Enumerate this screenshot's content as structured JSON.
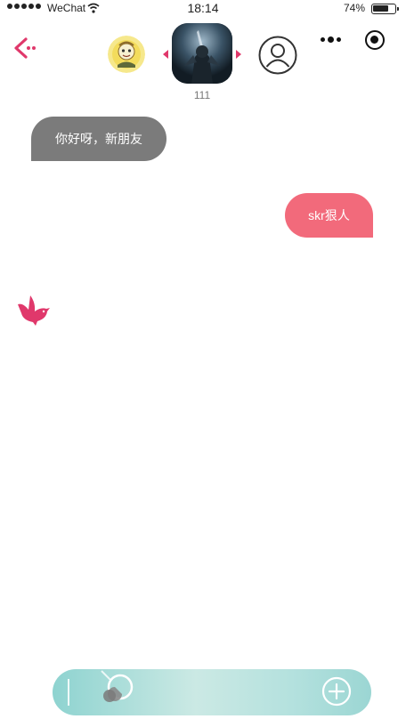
{
  "status_bar": {
    "carrier": "WeChat",
    "time": "18:14",
    "battery_percent": "74%",
    "battery_level": 0.74
  },
  "header": {
    "avatar_caption": "111"
  },
  "messages": [
    {
      "direction": "incoming",
      "text": "你好呀，新朋友"
    },
    {
      "direction": "outgoing",
      "text": "skr狠人"
    }
  ],
  "icons": {
    "back": "back-arrow-icon",
    "menu": "more-dots-icon",
    "target": "target-icon",
    "user": "user-outline-icon",
    "bird": "bird-icon",
    "voice": "voice-icon",
    "plus": "plus-circle-icon"
  },
  "colors": {
    "accent": "#e0386b",
    "incoming_bubble": "#7b7b7b",
    "outgoing_bubble": "#f26a7b",
    "input_bar": "#b4e1de"
  }
}
